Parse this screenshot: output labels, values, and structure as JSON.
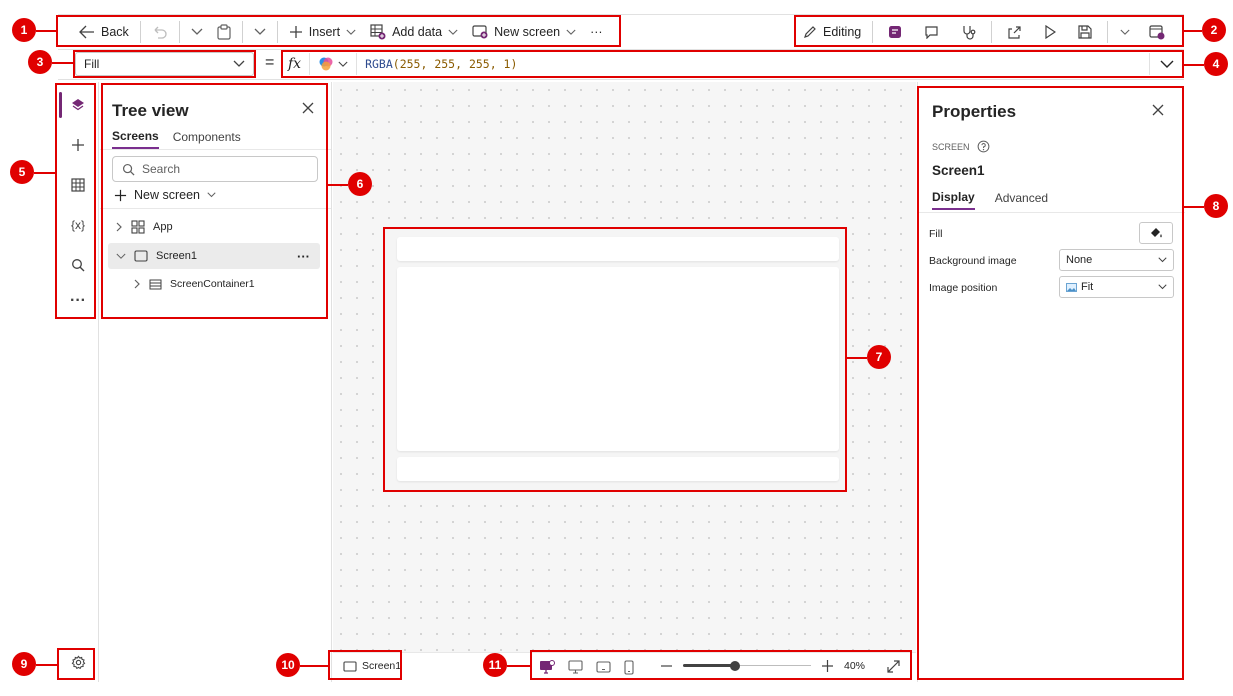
{
  "toolbar": {
    "back_label": "Back",
    "insert_label": "Insert",
    "add_data_label": "Add data",
    "new_screen_label": "New screen",
    "more_label": "···",
    "editing_label": "Editing"
  },
  "formula": {
    "property_value": "Fill",
    "equals": "=",
    "fx_label": "fx",
    "fn_name": "RGBA",
    "args": "(255, 255, 255, 1)"
  },
  "tree": {
    "title": "Tree view",
    "tabs": [
      "Screens",
      "Components"
    ],
    "search_placeholder": "Search",
    "new_screen_label": "New screen",
    "items": [
      {
        "label": "App"
      },
      {
        "label": "Screen1",
        "more": "···"
      },
      {
        "label": "ScreenContainer1"
      }
    ]
  },
  "properties": {
    "title": "Properties",
    "section_label": "SCREEN",
    "screen_name": "Screen1",
    "tabs": [
      "Display",
      "Advanced"
    ],
    "fill_label": "Fill",
    "background_image_label": "Background image",
    "background_image_value": "None",
    "image_position_label": "Image position",
    "image_position_value": "Fit"
  },
  "status": {
    "screen_label": "Screen1",
    "zoom_label": "40%",
    "zoom_level": 0.4
  },
  "annotations": [
    "1",
    "2",
    "3",
    "4",
    "5",
    "6",
    "7",
    "8",
    "9",
    "10",
    "11"
  ],
  "colors": {
    "accent": "#742774",
    "annotation": "#e00000",
    "canvas_bg": "#f6f6f6"
  }
}
